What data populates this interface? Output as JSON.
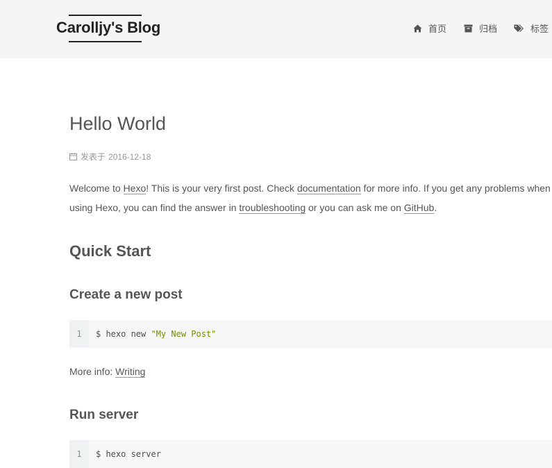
{
  "header": {
    "site_title": "Carolljy's Blog",
    "menu": [
      {
        "label": "首页",
        "icon": "home-icon"
      },
      {
        "label": "归档",
        "icon": "archive-icon"
      },
      {
        "label": "标签",
        "icon": "tags-icon"
      }
    ]
  },
  "post": {
    "title": "Hello World",
    "meta_prefix": "发表于",
    "date": "2016-12-18",
    "intro": {
      "t1": "Welcome to ",
      "link_hexo": "Hexo",
      "t2": "! This is your very first post. Check ",
      "link_docs": "documentation",
      "t3": " for more info. If you get any problems when",
      "t4": "using Hexo, you can find the answer in ",
      "link_troubleshooting": "troubleshooting",
      "t5": " or you can ask me on ",
      "link_github": "GitHub",
      "t6": "."
    },
    "quick_start_heading": "Quick Start",
    "create_post_heading": "Create a new post",
    "code1": {
      "line_no": "1",
      "cmd": "$ hexo new ",
      "arg": "\"My New Post\""
    },
    "more_info_prefix": "More info: ",
    "more_info_link": "Writing",
    "run_server_heading": "Run server",
    "code2": {
      "line_no": "1",
      "cmd": "$ hexo server"
    }
  },
  "colors": {
    "header_bg": "#f5f5f5",
    "text": "#555555",
    "code_string": "#718c00",
    "code_bg": "#f7f7f7",
    "gutter_bg": "#eff2f3"
  }
}
